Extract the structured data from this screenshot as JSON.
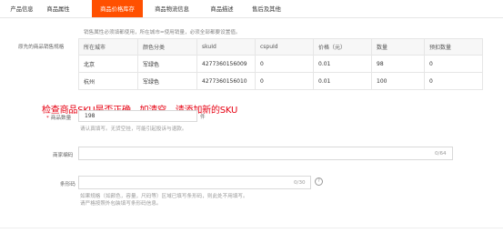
{
  "tabs": [
    "产品信息",
    "商品属性",
    "商品价格库存",
    "商品物流信息",
    "商品描述",
    "售后及其他"
  ],
  "active_tab": 2,
  "sales_attr_tip": "销售属性必须填都使用，所在城市=使用销量，必须全部都要设置值。",
  "sku_label": "原先的商品销售规格",
  "table": {
    "headers": [
      "所在城市",
      "颜色分类",
      "skuId",
      "cspuId",
      "价格（元）",
      "数量",
      "预扣数量"
    ],
    "rows": [
      [
        "北京",
        "军绿色",
        "4277360156009",
        "0",
        "0.01",
        "98",
        "0"
      ],
      [
        "杭州",
        "军绿色",
        "4277360156010",
        "0",
        "0.01",
        "100",
        "0"
      ]
    ]
  },
  "annotation": "检查商品SKU是否正确，如清空，请添加新的SKU",
  "quantity": {
    "label": "商品数量",
    "value": "198",
    "unit": "件",
    "hint": "请认真填写。无货空挂，可能引起投诉与退款。"
  },
  "merchant_code": {
    "label": "商家编码",
    "counter": "0/64"
  },
  "barcode": {
    "label": "条形码",
    "counter": "0/30",
    "help": "?",
    "hint_line1": "如果规格（如颜色，容量，尺码等）区域已填写条形码，则此处不用填写。",
    "hint_line2": "请严格按照外包装填写条形码信息。"
  }
}
